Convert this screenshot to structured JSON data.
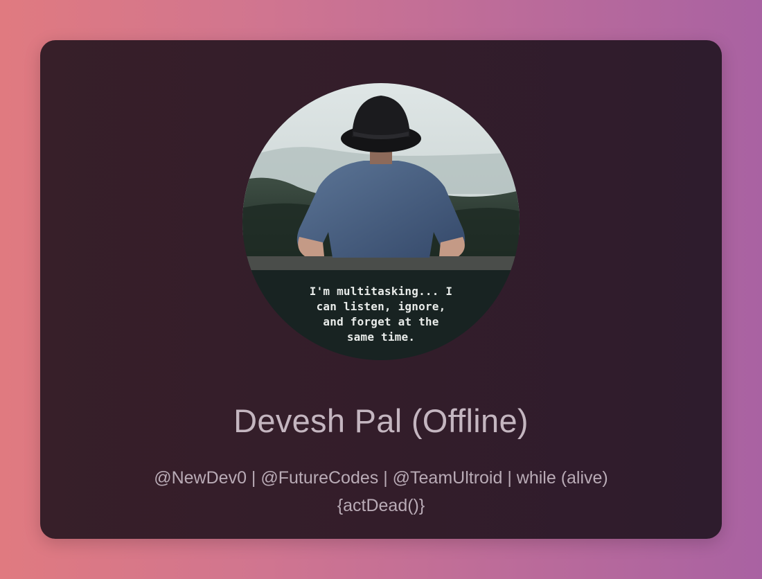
{
  "profile": {
    "avatar_caption_lines": [
      "I'm multitasking... I",
      "can listen, ignore,",
      "and forget at the",
      "same time."
    ],
    "name": "Devesh Pal (Offline)",
    "bio": "@NewDev0 | @FutureCodes | @TeamUltroid | while (alive) {actDead()}"
  },
  "colors": {
    "page_gradient_start": "#e07a80",
    "page_gradient_end": "#a962a2",
    "card_background": "#331d2a",
    "name_text": "#c4b6c0",
    "bio_text": "#b9abb6"
  }
}
